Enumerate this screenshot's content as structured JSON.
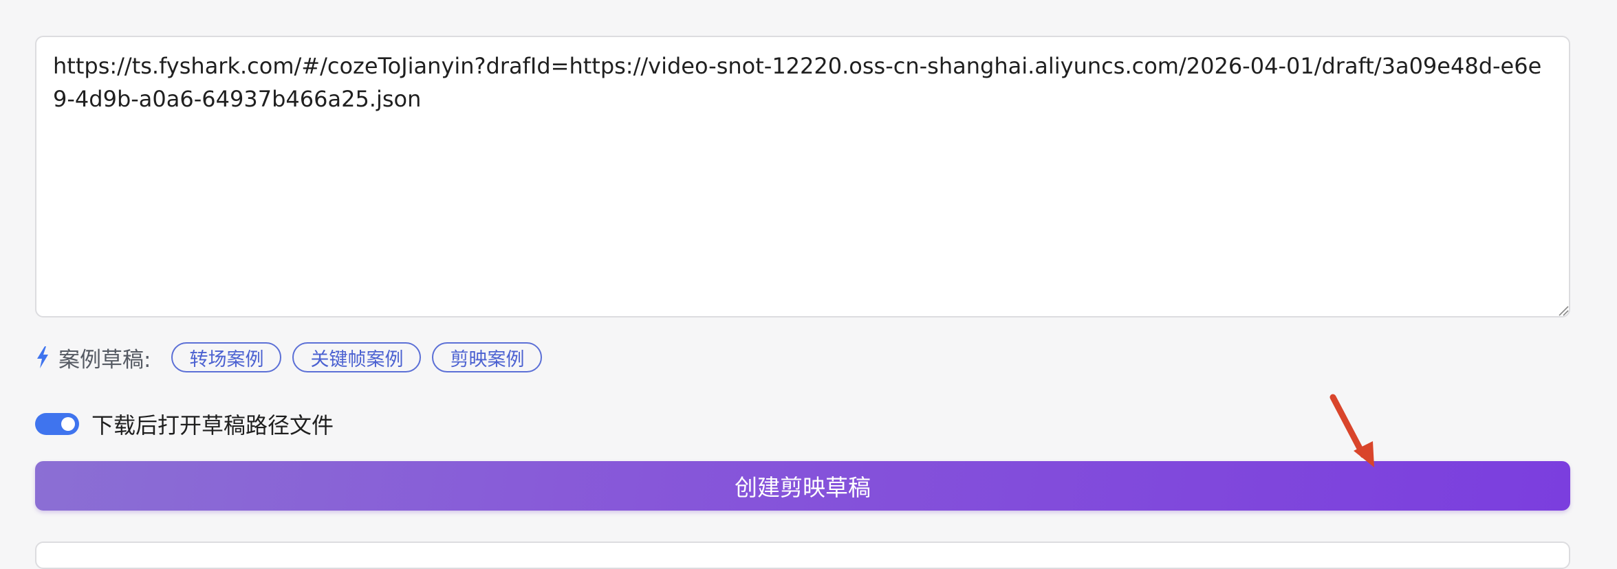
{
  "draft_input": {
    "value": "https://ts.fyshark.com/#/cozeToJianyin?drafId=https://video-snot-12220.oss-cn-shanghai.aliyuncs.com/2026-04-01/draft/3a09e48d-e6e9-4d9b-a0a6-64937b466a25.json"
  },
  "examples": {
    "icon": "bolt-icon",
    "label": "案例草稿:",
    "items": [
      {
        "label": "转场案例"
      },
      {
        "label": "关键帧案例"
      },
      {
        "label": "剪映案例"
      }
    ]
  },
  "open_after_download": {
    "enabled": true,
    "label": "下载后打开草稿路径文件"
  },
  "create_button": {
    "label": "创建剪映草稿"
  },
  "colors": {
    "accent": "#3f74ee",
    "chip_border": "#5b6fd6",
    "button_gradient_start": "#8b6fd4",
    "button_gradient_end": "#7b3ede",
    "annotation_arrow": "#d9452b"
  }
}
